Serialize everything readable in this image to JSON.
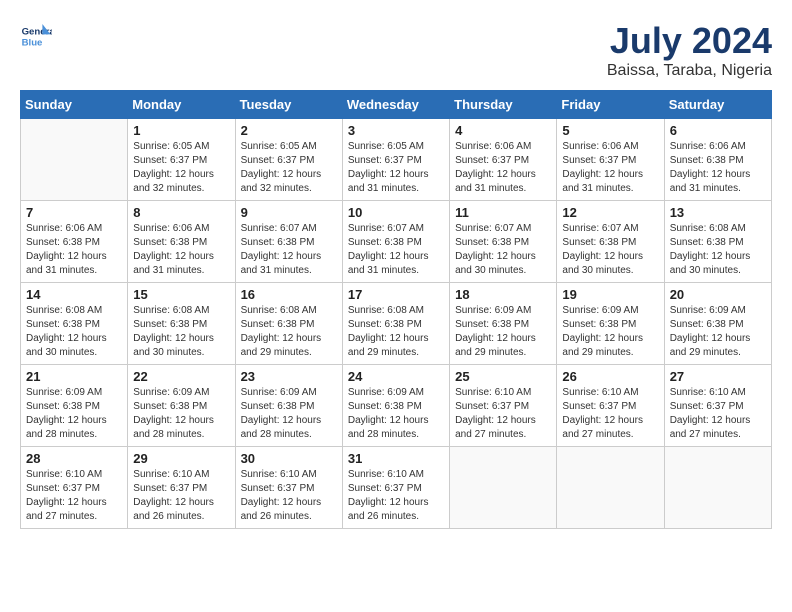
{
  "header": {
    "logo_line1": "General",
    "logo_line2": "Blue",
    "month_year": "July 2024",
    "location": "Baissa, Taraba, Nigeria"
  },
  "weekdays": [
    "Sunday",
    "Monday",
    "Tuesday",
    "Wednesday",
    "Thursday",
    "Friday",
    "Saturday"
  ],
  "weeks": [
    [
      {
        "day": "",
        "sunrise": "",
        "sunset": "",
        "daylight": ""
      },
      {
        "day": "1",
        "sunrise": "Sunrise: 6:05 AM",
        "sunset": "Sunset: 6:37 PM",
        "daylight": "Daylight: 12 hours and 32 minutes."
      },
      {
        "day": "2",
        "sunrise": "Sunrise: 6:05 AM",
        "sunset": "Sunset: 6:37 PM",
        "daylight": "Daylight: 12 hours and 32 minutes."
      },
      {
        "day": "3",
        "sunrise": "Sunrise: 6:05 AM",
        "sunset": "Sunset: 6:37 PM",
        "daylight": "Daylight: 12 hours and 31 minutes."
      },
      {
        "day": "4",
        "sunrise": "Sunrise: 6:06 AM",
        "sunset": "Sunset: 6:37 PM",
        "daylight": "Daylight: 12 hours and 31 minutes."
      },
      {
        "day": "5",
        "sunrise": "Sunrise: 6:06 AM",
        "sunset": "Sunset: 6:37 PM",
        "daylight": "Daylight: 12 hours and 31 minutes."
      },
      {
        "day": "6",
        "sunrise": "Sunrise: 6:06 AM",
        "sunset": "Sunset: 6:38 PM",
        "daylight": "Daylight: 12 hours and 31 minutes."
      }
    ],
    [
      {
        "day": "7",
        "sunrise": "Sunrise: 6:06 AM",
        "sunset": "Sunset: 6:38 PM",
        "daylight": "Daylight: 12 hours and 31 minutes."
      },
      {
        "day": "8",
        "sunrise": "Sunrise: 6:06 AM",
        "sunset": "Sunset: 6:38 PM",
        "daylight": "Daylight: 12 hours and 31 minutes."
      },
      {
        "day": "9",
        "sunrise": "Sunrise: 6:07 AM",
        "sunset": "Sunset: 6:38 PM",
        "daylight": "Daylight: 12 hours and 31 minutes."
      },
      {
        "day": "10",
        "sunrise": "Sunrise: 6:07 AM",
        "sunset": "Sunset: 6:38 PM",
        "daylight": "Daylight: 12 hours and 31 minutes."
      },
      {
        "day": "11",
        "sunrise": "Sunrise: 6:07 AM",
        "sunset": "Sunset: 6:38 PM",
        "daylight": "Daylight: 12 hours and 30 minutes."
      },
      {
        "day": "12",
        "sunrise": "Sunrise: 6:07 AM",
        "sunset": "Sunset: 6:38 PM",
        "daylight": "Daylight: 12 hours and 30 minutes."
      },
      {
        "day": "13",
        "sunrise": "Sunrise: 6:08 AM",
        "sunset": "Sunset: 6:38 PM",
        "daylight": "Daylight: 12 hours and 30 minutes."
      }
    ],
    [
      {
        "day": "14",
        "sunrise": "Sunrise: 6:08 AM",
        "sunset": "Sunset: 6:38 PM",
        "daylight": "Daylight: 12 hours and 30 minutes."
      },
      {
        "day": "15",
        "sunrise": "Sunrise: 6:08 AM",
        "sunset": "Sunset: 6:38 PM",
        "daylight": "Daylight: 12 hours and 30 minutes."
      },
      {
        "day": "16",
        "sunrise": "Sunrise: 6:08 AM",
        "sunset": "Sunset: 6:38 PM",
        "daylight": "Daylight: 12 hours and 29 minutes."
      },
      {
        "day": "17",
        "sunrise": "Sunrise: 6:08 AM",
        "sunset": "Sunset: 6:38 PM",
        "daylight": "Daylight: 12 hours and 29 minutes."
      },
      {
        "day": "18",
        "sunrise": "Sunrise: 6:09 AM",
        "sunset": "Sunset: 6:38 PM",
        "daylight": "Daylight: 12 hours and 29 minutes."
      },
      {
        "day": "19",
        "sunrise": "Sunrise: 6:09 AM",
        "sunset": "Sunset: 6:38 PM",
        "daylight": "Daylight: 12 hours and 29 minutes."
      },
      {
        "day": "20",
        "sunrise": "Sunrise: 6:09 AM",
        "sunset": "Sunset: 6:38 PM",
        "daylight": "Daylight: 12 hours and 29 minutes."
      }
    ],
    [
      {
        "day": "21",
        "sunrise": "Sunrise: 6:09 AM",
        "sunset": "Sunset: 6:38 PM",
        "daylight": "Daylight: 12 hours and 28 minutes."
      },
      {
        "day": "22",
        "sunrise": "Sunrise: 6:09 AM",
        "sunset": "Sunset: 6:38 PM",
        "daylight": "Daylight: 12 hours and 28 minutes."
      },
      {
        "day": "23",
        "sunrise": "Sunrise: 6:09 AM",
        "sunset": "Sunset: 6:38 PM",
        "daylight": "Daylight: 12 hours and 28 minutes."
      },
      {
        "day": "24",
        "sunrise": "Sunrise: 6:09 AM",
        "sunset": "Sunset: 6:38 PM",
        "daylight": "Daylight: 12 hours and 28 minutes."
      },
      {
        "day": "25",
        "sunrise": "Sunrise: 6:10 AM",
        "sunset": "Sunset: 6:37 PM",
        "daylight": "Daylight: 12 hours and 27 minutes."
      },
      {
        "day": "26",
        "sunrise": "Sunrise: 6:10 AM",
        "sunset": "Sunset: 6:37 PM",
        "daylight": "Daylight: 12 hours and 27 minutes."
      },
      {
        "day": "27",
        "sunrise": "Sunrise: 6:10 AM",
        "sunset": "Sunset: 6:37 PM",
        "daylight": "Daylight: 12 hours and 27 minutes."
      }
    ],
    [
      {
        "day": "28",
        "sunrise": "Sunrise: 6:10 AM",
        "sunset": "Sunset: 6:37 PM",
        "daylight": "Daylight: 12 hours and 27 minutes."
      },
      {
        "day": "29",
        "sunrise": "Sunrise: 6:10 AM",
        "sunset": "Sunset: 6:37 PM",
        "daylight": "Daylight: 12 hours and 26 minutes."
      },
      {
        "day": "30",
        "sunrise": "Sunrise: 6:10 AM",
        "sunset": "Sunset: 6:37 PM",
        "daylight": "Daylight: 12 hours and 26 minutes."
      },
      {
        "day": "31",
        "sunrise": "Sunrise: 6:10 AM",
        "sunset": "Sunset: 6:37 PM",
        "daylight": "Daylight: 12 hours and 26 minutes."
      },
      {
        "day": "",
        "sunrise": "",
        "sunset": "",
        "daylight": ""
      },
      {
        "day": "",
        "sunrise": "",
        "sunset": "",
        "daylight": ""
      },
      {
        "day": "",
        "sunrise": "",
        "sunset": "",
        "daylight": ""
      }
    ]
  ]
}
